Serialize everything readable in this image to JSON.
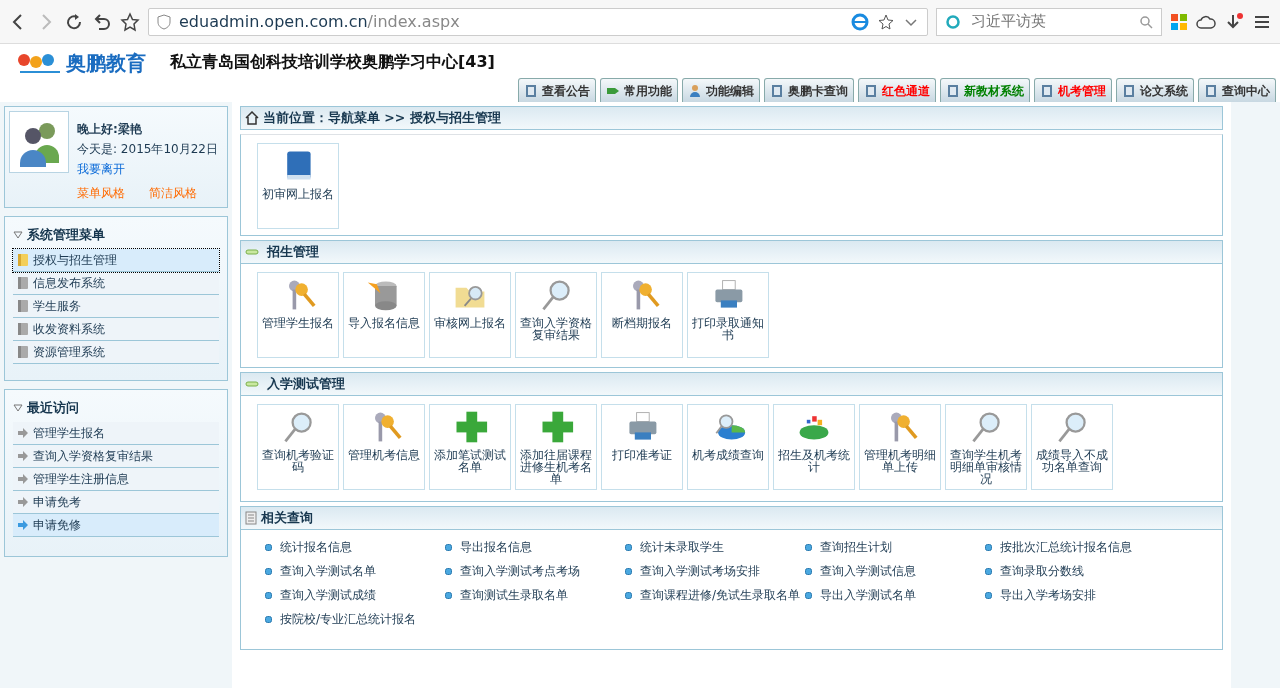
{
  "browser": {
    "url_host": "eduadmin.open.com.cn",
    "url_path": "/index.aspx",
    "search_placeholder": "习近平访英"
  },
  "header": {
    "brand": "奥鹏教育",
    "school": "私立青岛国创科技培训学校奥鹏学习中心[43]",
    "tabs": [
      {
        "label": "查看公告",
        "color": "#333333"
      },
      {
        "label": "常用功能",
        "color": "#333333"
      },
      {
        "label": "功能编辑",
        "color": "#333333"
      },
      {
        "label": "奥鹏卡查询",
        "color": "#333333"
      },
      {
        "label": "红色通道",
        "color": "#ff0000"
      },
      {
        "label": "新教材系统",
        "color": "#008000"
      },
      {
        "label": "机考管理",
        "color": "#ff0000"
      },
      {
        "label": "论文系统",
        "color": "#333333"
      },
      {
        "label": "查询中心",
        "color": "#333333"
      }
    ]
  },
  "user": {
    "greeting": "晚上好:",
    "name": "梁艳",
    "date": "今天是: 2015年10月22日",
    "logout": "我要离开",
    "styles": [
      "菜单风格",
      "简洁风格"
    ]
  },
  "menu": {
    "title": "系统管理菜单",
    "items": [
      {
        "label": "授权与招生管理",
        "selected": true
      },
      {
        "label": "信息发布系统",
        "selected": false
      },
      {
        "label": "学生服务",
        "selected": false
      },
      {
        "label": "收发资料系统",
        "selected": false
      },
      {
        "label": "资源管理系统",
        "selected": false
      }
    ]
  },
  "recent": {
    "title": "最近访问",
    "items": [
      {
        "label": "管理学生报名",
        "selected": false
      },
      {
        "label": "查询入学资格复审结果",
        "selected": false
      },
      {
        "label": "管理学生注册信息",
        "selected": false
      },
      {
        "label": "申请免考",
        "selected": false
      },
      {
        "label": "申请免修",
        "selected": true
      }
    ]
  },
  "breadcrumb": "当前位置：导航菜单 >> 授权与招生管理",
  "top_tiles": [
    {
      "label": "初审网上报名",
      "kind": "book"
    }
  ],
  "sections": [
    {
      "title": "招生管理",
      "tiles": [
        {
          "label": "管理学生报名",
          "kind": "key"
        },
        {
          "label": "导入报名信息",
          "kind": "database"
        },
        {
          "label": "审核网上报名",
          "kind": "folder"
        },
        {
          "label": "查询入学资格复审结果",
          "kind": "magnifier"
        },
        {
          "label": "断档期报名",
          "kind": "key"
        },
        {
          "label": "打印录取通知书",
          "kind": "printer"
        }
      ]
    },
    {
      "title": "入学测试管理",
      "tiles": [
        {
          "label": "查询机考验证码",
          "kind": "magnifier"
        },
        {
          "label": "管理机考信息",
          "kind": "key"
        },
        {
          "label": "添加笔试测试名单",
          "kind": "plus"
        },
        {
          "label": "添加往届课程进修生机考名单",
          "kind": "plus"
        },
        {
          "label": "打印准考证",
          "kind": "printer"
        },
        {
          "label": "机考成绩查询",
          "kind": "piesearch"
        },
        {
          "label": "招生及机考统计",
          "kind": "pie"
        },
        {
          "label": "管理机考明细单上传",
          "kind": "key"
        },
        {
          "label": "查询学生机考明细单审核情况",
          "kind": "magnifier"
        },
        {
          "label": "成绩导入不成功名单查询",
          "kind": "magnifier"
        }
      ]
    }
  ],
  "queries": {
    "title": "相关查询",
    "links": [
      "统计报名信息",
      "导出报名信息",
      "统计未录取学生",
      "查询招生计划",
      "按批次汇总统计报名信息",
      "查询入学测试名单",
      "查询入学测试考点考场",
      "查询入学测试考场安排",
      "查询入学测试信息",
      "查询录取分数线",
      "查询入学测试成绩",
      "查询测试生录取名单",
      "查询课程进修/免试生录取名单",
      "导出入学测试名单",
      "导出入学考场安排",
      "按院校/专业汇总统计报名"
    ]
  }
}
